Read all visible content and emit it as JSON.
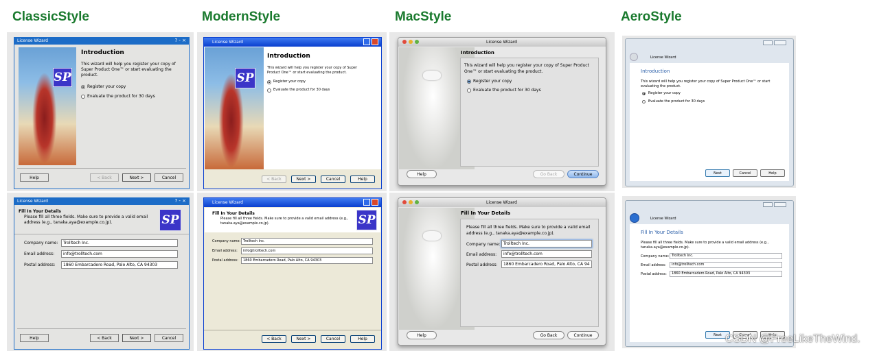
{
  "headings": {
    "classic": "ClassicStyle",
    "modern": "ModernStyle",
    "mac": "MacStyle",
    "aero": "AeroStyle"
  },
  "window_title": "License Wizard",
  "logo_text": "SP",
  "intro": {
    "title": "Introduction",
    "text": "This wizard will help you register your copy of Super Product One™ or start evaluating the product.",
    "option_register": "Register your copy",
    "option_evaluate": "Evaluate the product for 30 days"
  },
  "details": {
    "title": "Fill In Your Details",
    "text": "Please fill all three fields. Make sure to provide a valid email address (e.g., tanaka.aya@example.co.jp).",
    "company_label": "Company name:",
    "company_value": "Trolltech Inc.",
    "email_label": "Email address:",
    "email_value": "info@trolltech.com",
    "postal_label": "Postal address:",
    "postal_value": "1860 Embarcadero Road, Palo Alto, CA 94303",
    "postal_value_mac": "1860 Embarcadero Road, Palo Alto, CA 94"
  },
  "buttons": {
    "help": "Help",
    "back": "< Back",
    "next": "Next >",
    "cancel": "Cancel",
    "go_back": "Go Back",
    "continue": "Continue",
    "next_aero": "Next"
  },
  "titlebar_controls": {
    "classic": "? - ×",
    "aero": "?  ✕"
  },
  "watermark": "CSDN @FreeLikeTheWind.",
  "colors": {
    "heading": "#1a7a2e",
    "xp_blue": "#0a3fcf",
    "classic_blue": "#1c6cc7",
    "aero_link": "#2a5ea8"
  }
}
